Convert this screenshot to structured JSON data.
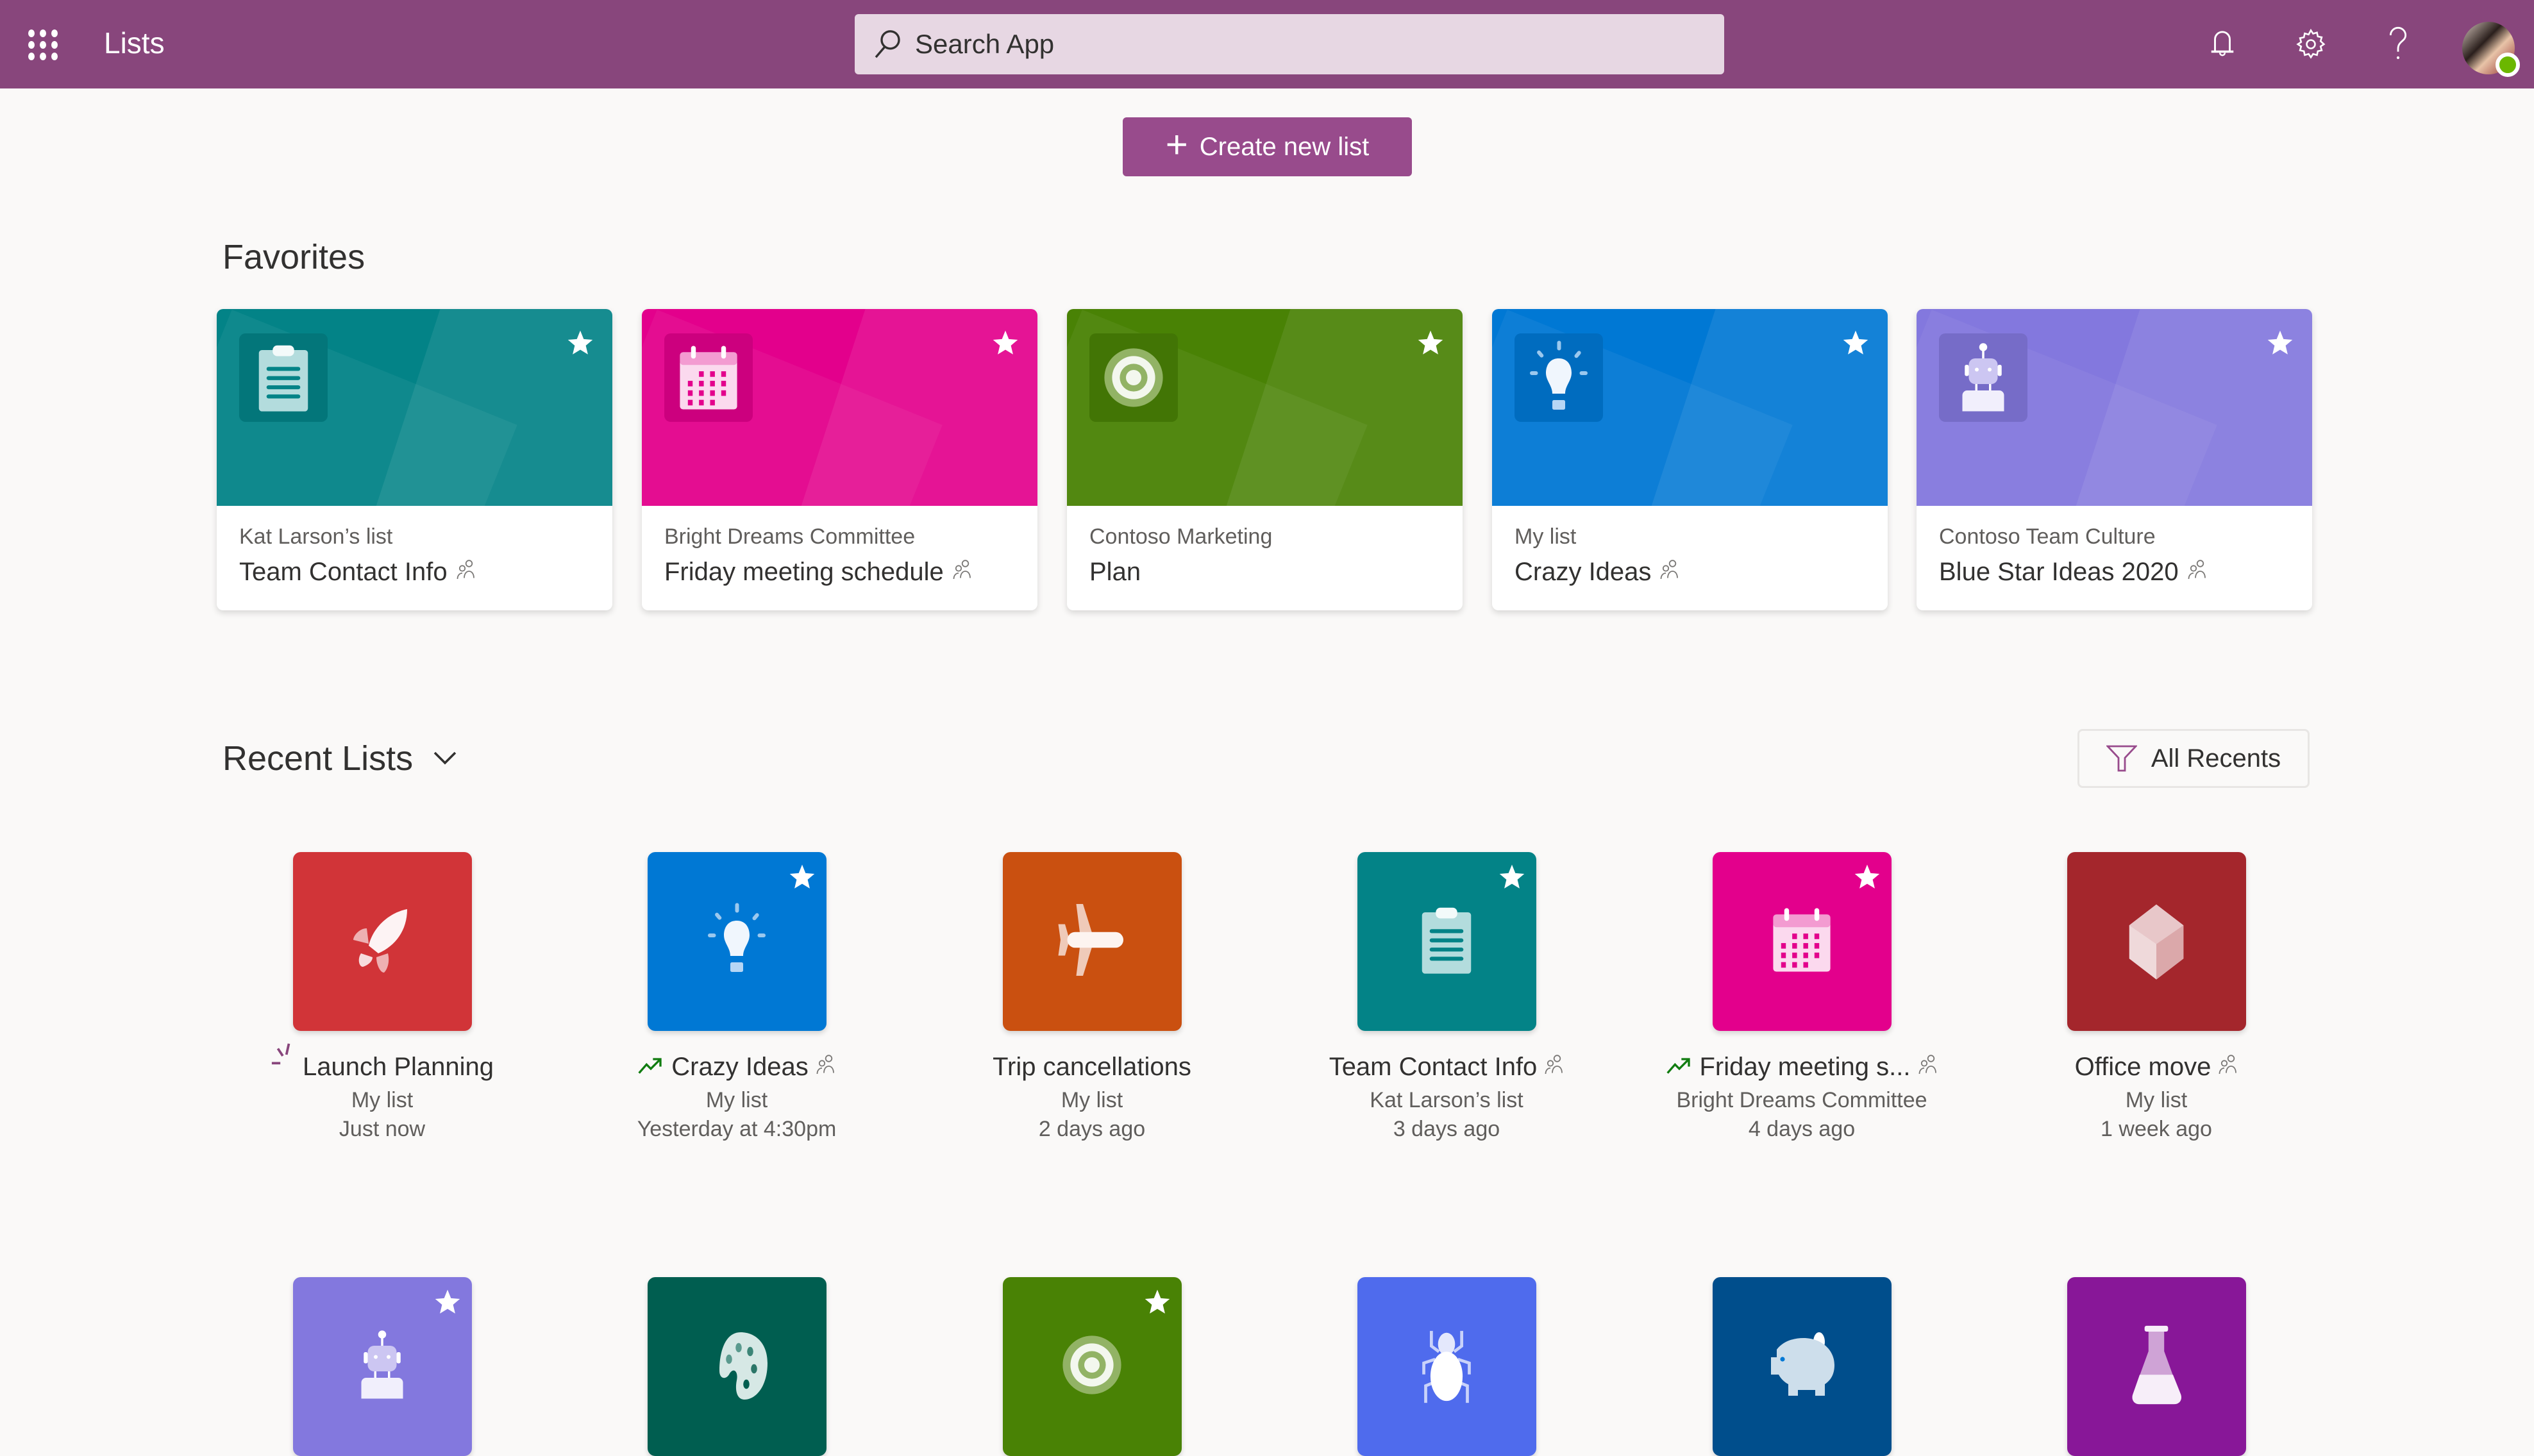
{
  "header": {
    "app_title": "Lists",
    "search_placeholder": "Search App",
    "icons": [
      "app-launcher-icon",
      "bell-icon",
      "gear-icon",
      "help-icon",
      "avatar"
    ],
    "brand_color": "#88467c"
  },
  "create_button": {
    "label": "Create new list",
    "icon": "plus-icon",
    "color": "#984b8c"
  },
  "favorites": {
    "title": "Favorites",
    "cards": [
      {
        "owner": "Kat Larson’s list",
        "name": "Team Contact Info",
        "shared": true,
        "icon": "clipboard-icon",
        "color": "#038387",
        "favorited": true
      },
      {
        "owner": "Bright Dreams Committee",
        "name": "Friday meeting schedule",
        "shared": true,
        "icon": "calendar-icon",
        "color": "#e3008c",
        "favorited": true
      },
      {
        "owner": "Contoso Marketing",
        "name": "Plan",
        "shared": false,
        "icon": "target-icon",
        "color": "#498205",
        "favorited": true
      },
      {
        "owner": "My list",
        "name": "Crazy Ideas",
        "shared": true,
        "icon": "lightbulb-icon",
        "color": "#0078d4",
        "favorited": true
      },
      {
        "owner": "Contoso Team Culture",
        "name": "Blue Star Ideas 2020",
        "shared": true,
        "icon": "robot-icon",
        "color": "#8378de",
        "favorited": true
      }
    ]
  },
  "recent": {
    "title": "Recent Lists",
    "filter_label": "All Recents",
    "items": [
      {
        "name": "Launch Planning",
        "owner": "My list",
        "time": "Just now",
        "shared": false,
        "badge": "new",
        "icon": "rocket-icon",
        "color": "#d13438",
        "favorited": false
      },
      {
        "name": "Crazy Ideas",
        "owner": "My list",
        "time": "Yesterday at 4:30pm",
        "shared": true,
        "badge": "trending",
        "icon": "lightbulb-icon",
        "color": "#0078d4",
        "favorited": true
      },
      {
        "name": "Trip cancellations",
        "owner": "My list",
        "time": "2 days ago",
        "shared": false,
        "badge": "",
        "icon": "airplane-icon",
        "color": "#ca5010",
        "favorited": false
      },
      {
        "name": "Team Contact Info",
        "owner": "Kat Larson’s list",
        "time": "3 days ago",
        "shared": true,
        "badge": "",
        "icon": "clipboard-icon",
        "color": "#038387",
        "favorited": true
      },
      {
        "name": "Friday meeting s...",
        "owner": "Bright Dreams Committee",
        "time": "4 days ago",
        "shared": true,
        "badge": "trending",
        "icon": "calendar-icon",
        "color": "#e3008c",
        "favorited": true
      },
      {
        "name": "Office move",
        "owner": "My list",
        "time": "1 week ago",
        "shared": true,
        "badge": "",
        "icon": "cube-icon",
        "color": "#a4262c",
        "favorited": false
      },
      {
        "icon": "robot-icon",
        "color": "#8378de",
        "favorited": true
      },
      {
        "icon": "palette-icon",
        "color": "#005e50",
        "favorited": false
      },
      {
        "icon": "target-icon",
        "color": "#498205",
        "favorited": true
      },
      {
        "icon": "bug-icon",
        "color": "#4f6bed",
        "favorited": false
      },
      {
        "icon": "piggy-bank-icon",
        "color": "#004e8c",
        "favorited": false
      },
      {
        "icon": "flask-icon",
        "color": "#881798",
        "favorited": false
      }
    ]
  }
}
